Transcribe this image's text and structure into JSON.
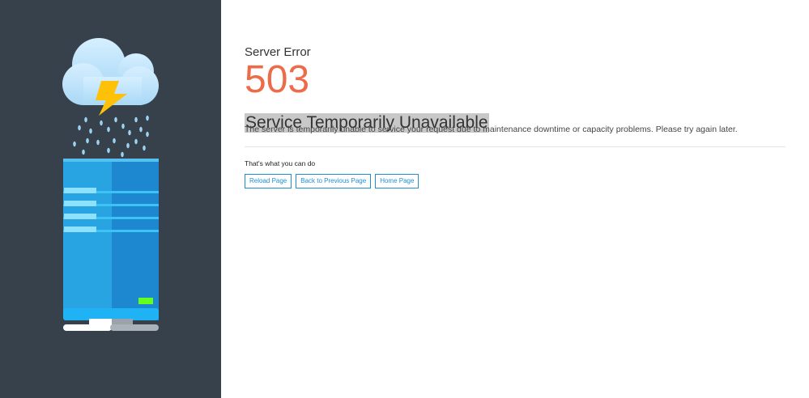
{
  "error": {
    "subtitle": "Server Error",
    "code": "503",
    "headline": "Service Temporarily Unavailable",
    "description": "The server is temporarily unable to service your request due to maintenance downtime or capacity problems. Please try again later."
  },
  "help": {
    "text": "That's what you can do"
  },
  "actions": [
    {
      "label": "Reload Page"
    },
    {
      "label": "Back to Previous Page"
    },
    {
      "label": "Home Page"
    }
  ],
  "colors": {
    "sidebar": "#36414c",
    "accent_code": "#ec6c4a",
    "button": "#1e8fd4",
    "server": "#29a4e2",
    "led": "#64ff1e",
    "lightning": "#ffc107"
  },
  "icons": {
    "cloud": "cloud-icon",
    "lightning": "lightning-icon",
    "rain": "rain-icon",
    "server": "server-icon"
  }
}
